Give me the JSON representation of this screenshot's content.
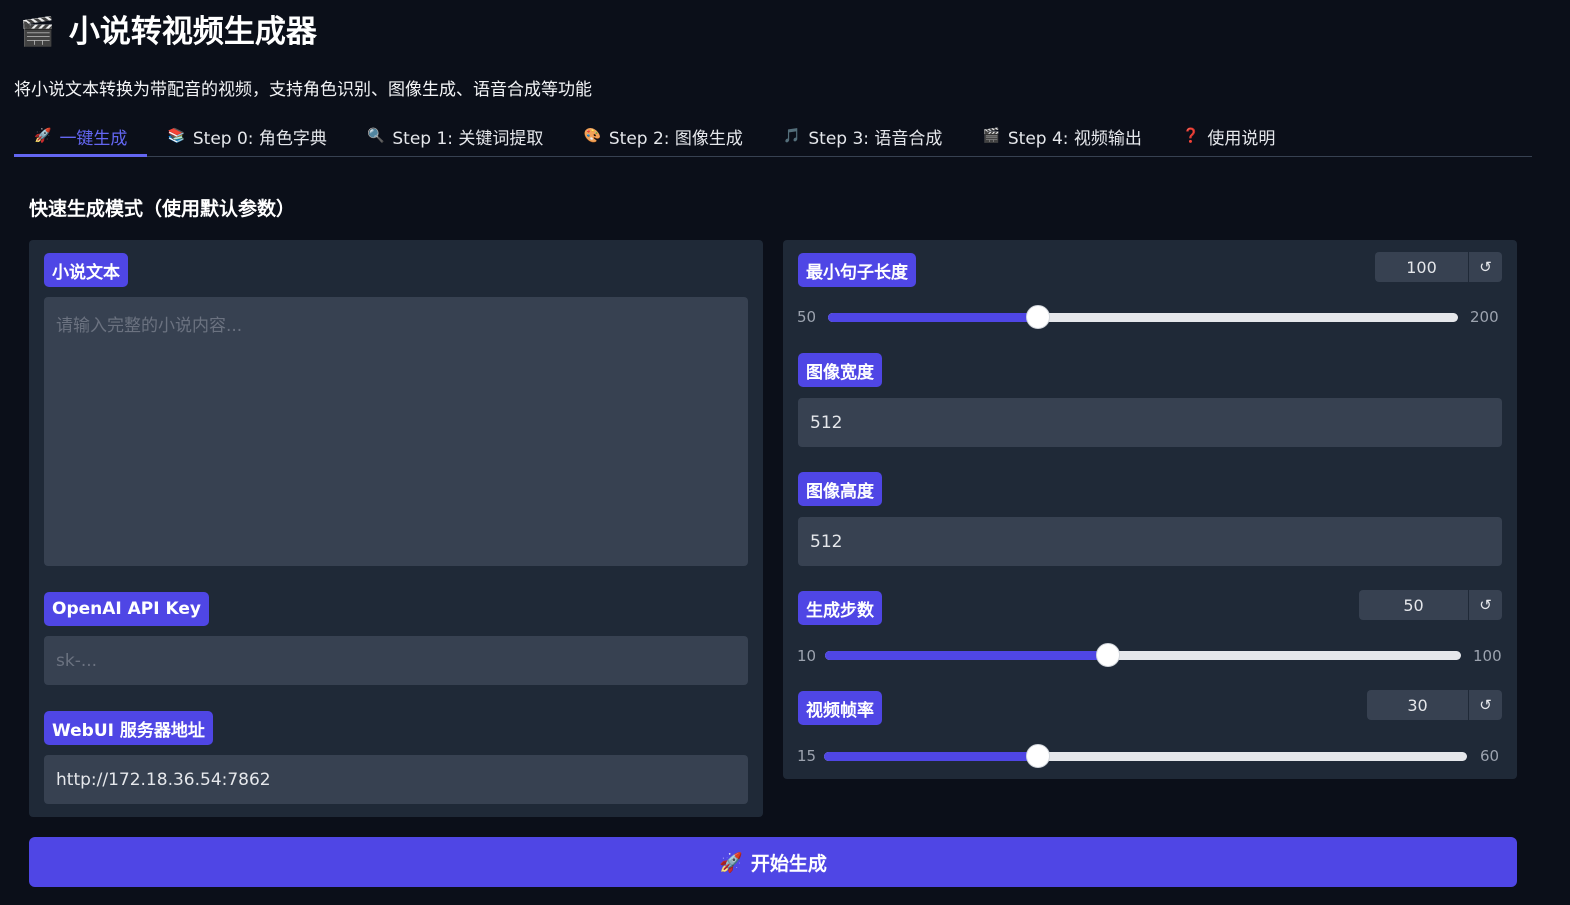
{
  "app": {
    "icon": "clapperboard-icon",
    "title": "小说转视频生成器",
    "subtitle": "将小说文本转换为带配音的视频，支持角色识别、图像生成、语音合成等功能"
  },
  "tabs": [
    {
      "icon": "🚀",
      "label": "一键生成",
      "active": true
    },
    {
      "icon": "📚",
      "label": "Step 0: 角色字典"
    },
    {
      "icon": "🔍",
      "label": "Step 1: 关键词提取"
    },
    {
      "icon": "🎨",
      "label": "Step 2: 图像生成"
    },
    {
      "icon": "🎵",
      "label": "Step 3: 语音合成"
    },
    {
      "icon": "🎬",
      "label": "Step 4: 视频输出"
    },
    {
      "icon": "❓",
      "label": "使用说明"
    }
  ],
  "section_title": "快速生成模式（使用默认参数）",
  "left": {
    "novel_text": {
      "label": "小说文本",
      "placeholder": "请输入完整的小说内容..."
    },
    "api_key": {
      "label": "OpenAI API Key",
      "placeholder": "sk-..."
    },
    "webui": {
      "label": "WebUI 服务器地址",
      "value": "http://172.18.36.54:7862"
    }
  },
  "right": {
    "min_sentence": {
      "label": "最小句子长度",
      "value": 100,
      "min": 50,
      "max": 200,
      "min_text": "50",
      "max_text": "200",
      "value_text": "100"
    },
    "width": {
      "label": "图像宽度",
      "value": "512"
    },
    "height": {
      "label": "图像高度",
      "value": "512"
    },
    "steps": {
      "label": "生成步数",
      "value": 50,
      "min": 10,
      "max": 100,
      "min_text": "10",
      "max_text": "100",
      "value_text": "50"
    },
    "fps": {
      "label": "视频帧率",
      "value": 30,
      "min": 15,
      "max": 60,
      "min_text": "15",
      "max_text": "60",
      "value_text": "30"
    },
    "reset_glyph": "↺"
  },
  "generate_button": {
    "icon": "🚀",
    "label": "开始生成"
  }
}
